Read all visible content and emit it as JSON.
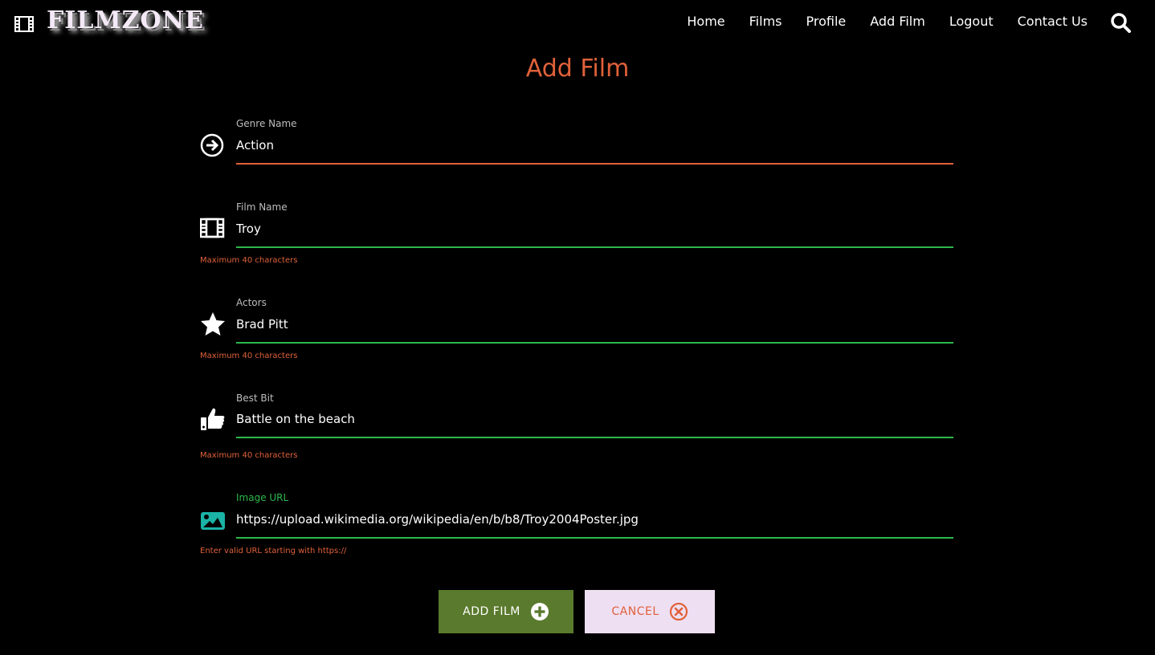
{
  "navbar": {
    "brand": "FILMZONE",
    "links": [
      "Home",
      "Films",
      "Profile",
      "Add Film",
      "Logout",
      "Contact Us"
    ]
  },
  "page": {
    "title": "Add Film"
  },
  "form": {
    "genre": {
      "label": "Genre Name",
      "value": "Action"
    },
    "film_name": {
      "label": "Film Name",
      "value": "Troy",
      "helper": "Maximum 40 characters"
    },
    "actors": {
      "label": "Actors",
      "value": "Brad Pitt",
      "helper": "Maximum 40 characters"
    },
    "best_bit": {
      "label": "Best Bit",
      "value": "Battle on the beach",
      "helper": "Maximum 40 characters"
    },
    "image_url": {
      "label": "Image URL",
      "value": "https://upload.wikimedia.org/wikipedia/en/b/b8/Troy2004Poster.jpg",
      "helper": "Enter valid URL starting with https://"
    }
  },
  "buttons": {
    "add": "ADD FILM",
    "cancel": "CANCEL"
  },
  "colors": {
    "accent": "#e0613a",
    "valid": "#2db84c",
    "invalid": "#e0613a",
    "add_button": "#5a7a2d",
    "cancel_button": "#efdff2",
    "image_icon": "#1ab3a6"
  },
  "icons": {
    "brand": "film-icon",
    "search": "search-icon",
    "genre": "arrow-circle-right-icon",
    "film_name": "film-icon",
    "actors": "star-icon",
    "best_bit": "thumbs-up-icon",
    "image_url": "image-icon",
    "add": "plus-circle-icon",
    "cancel": "times-circle-icon"
  }
}
